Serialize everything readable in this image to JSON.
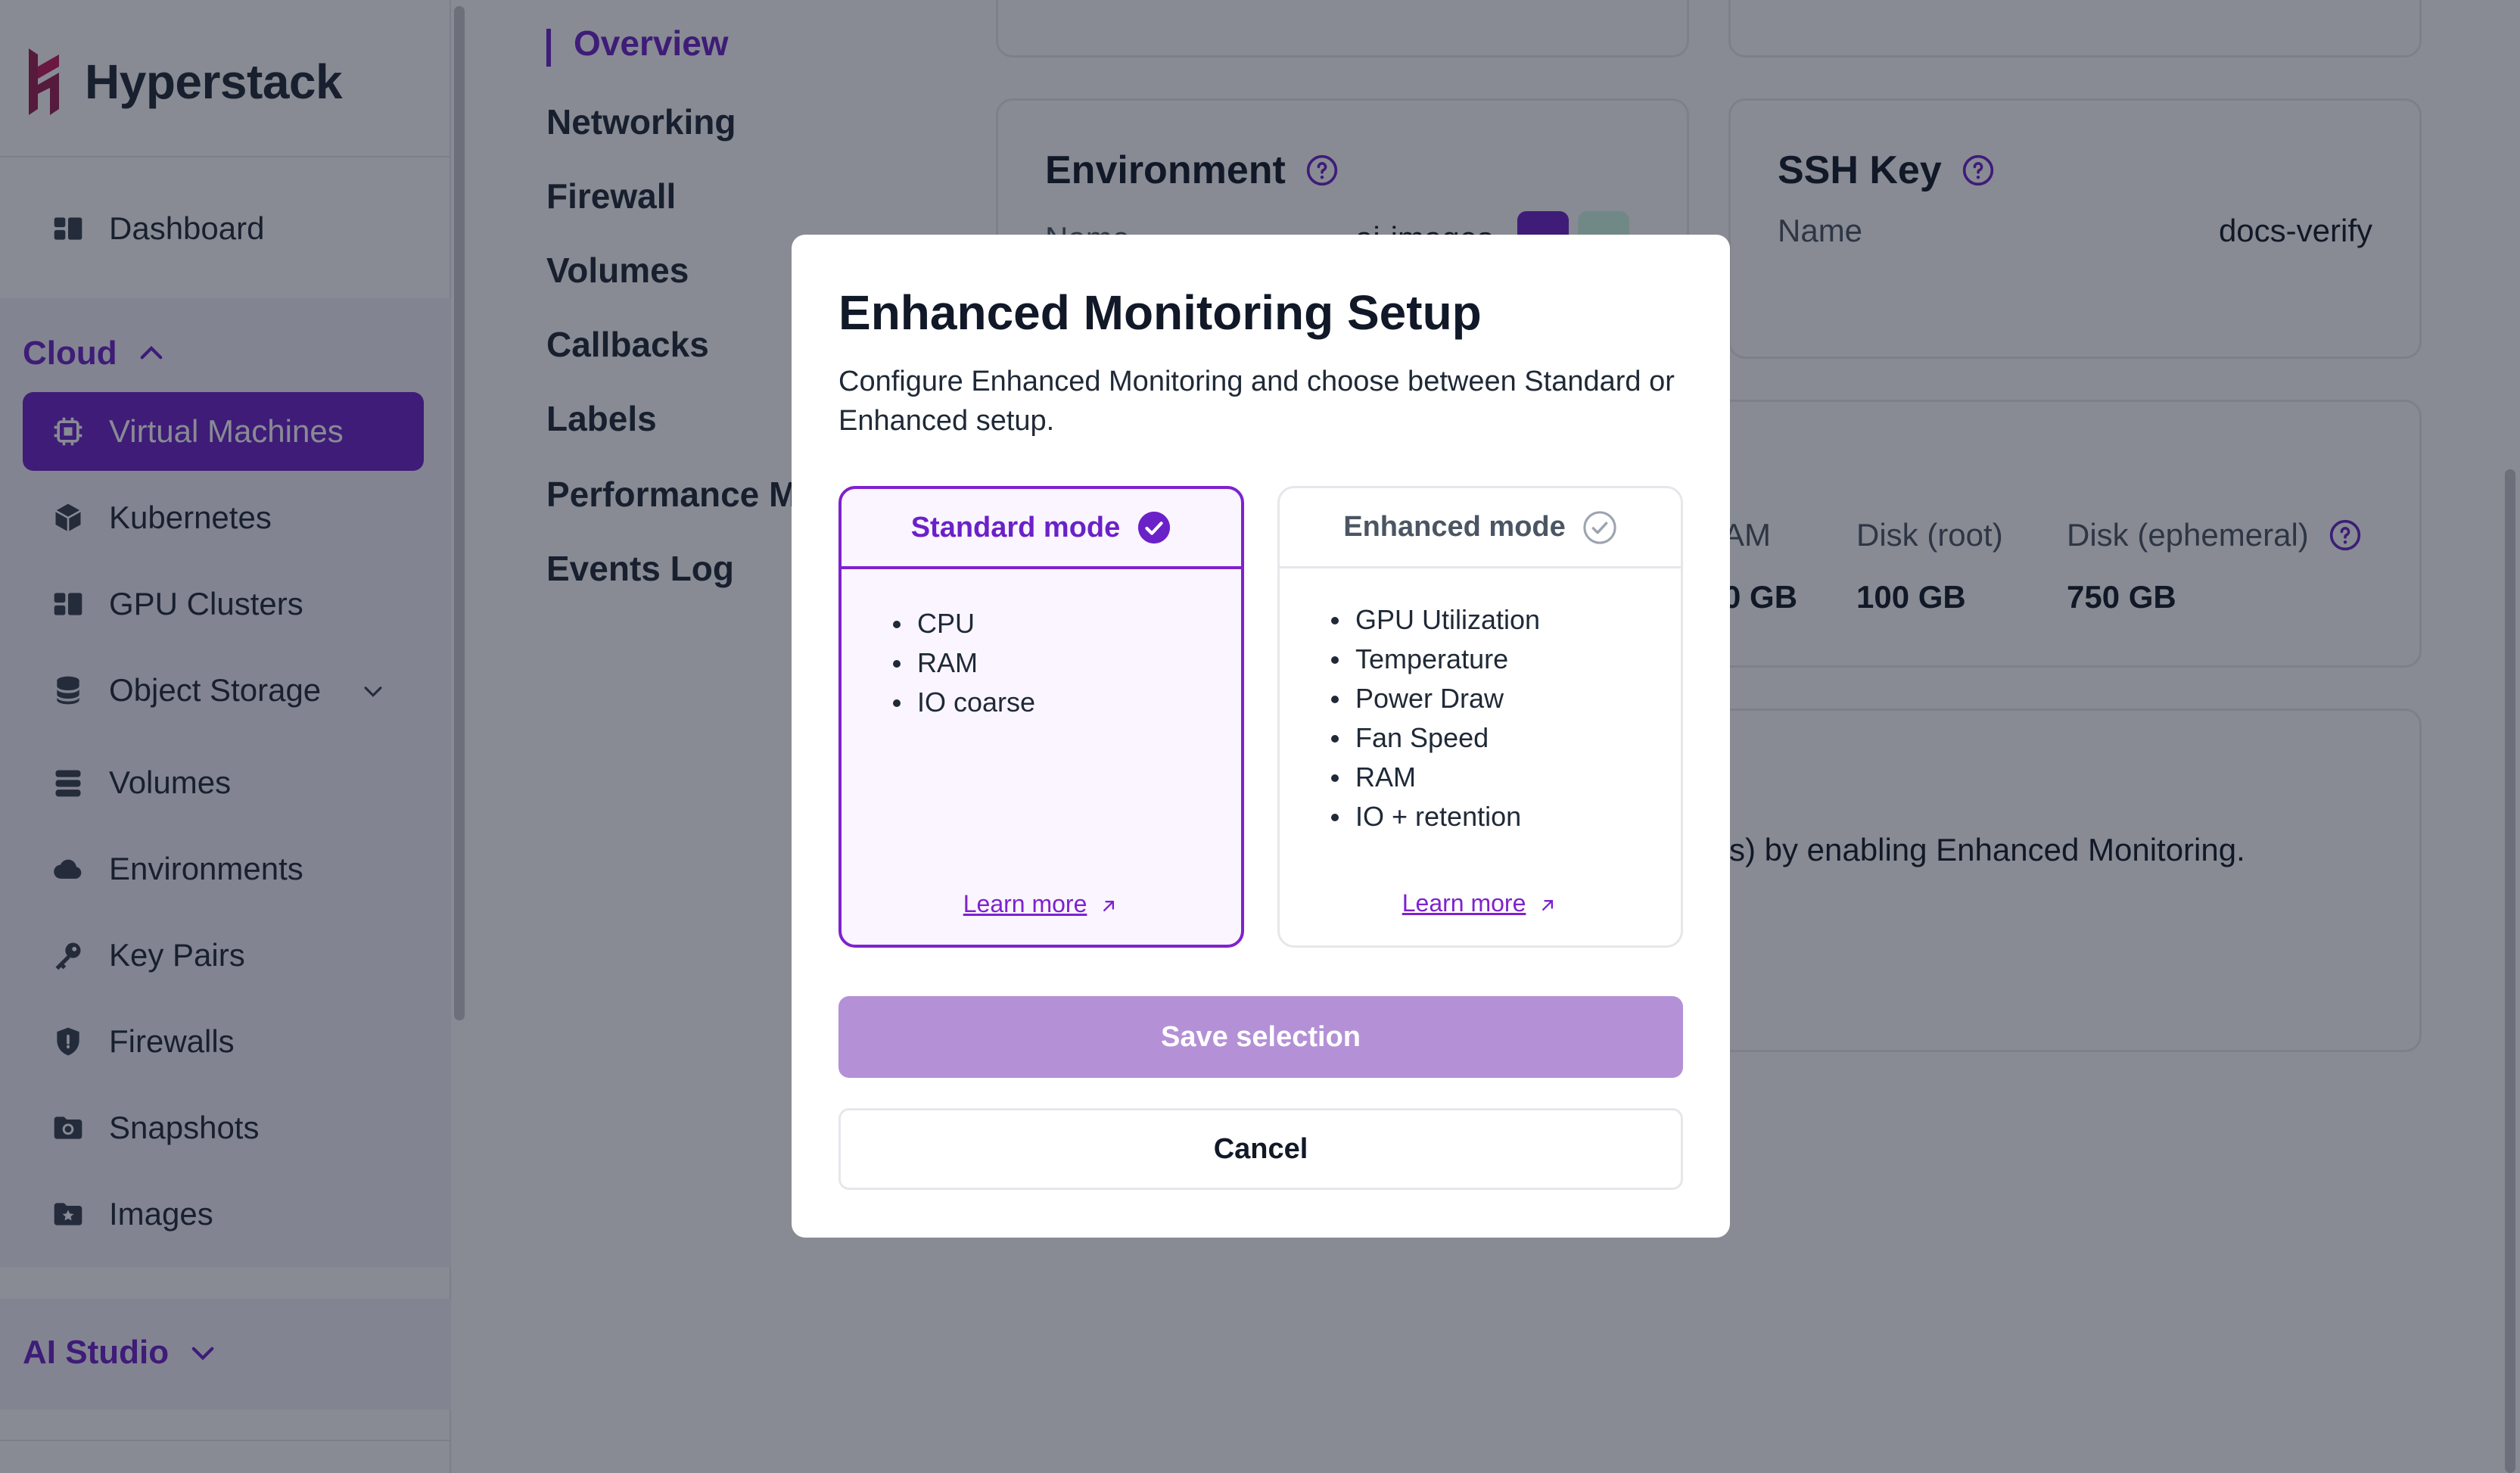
{
  "brand": {
    "name": "Hyperstack"
  },
  "sidebar": {
    "top_items": [
      {
        "label": "Dashboard",
        "icon": "dashboard-icon"
      }
    ],
    "cloud_section": {
      "label": "Cloud",
      "items": [
        {
          "label": "Virtual Machines",
          "icon": "chip-icon",
          "active": true
        },
        {
          "label": "Kubernetes",
          "icon": "cube-icon"
        },
        {
          "label": "GPU Clusters",
          "icon": "dashboard-icon"
        },
        {
          "label": "Object Storage",
          "icon": "database-icon",
          "has_submenu": true
        },
        {
          "label": "Volumes",
          "icon": "stack-icon"
        },
        {
          "label": "Environments",
          "icon": "cloud-icon"
        },
        {
          "label": "Key Pairs",
          "icon": "key-icon"
        },
        {
          "label": "Firewalls",
          "icon": "shield-icon"
        },
        {
          "label": "Snapshots",
          "icon": "snapshot-icon"
        },
        {
          "label": "Images",
          "icon": "image-icon"
        }
      ]
    },
    "ai_section": {
      "label": "AI Studio"
    }
  },
  "tabs": [
    {
      "label": "Overview",
      "active": true
    },
    {
      "label": "Networking"
    },
    {
      "label": "Firewall"
    },
    {
      "label": "Volumes"
    },
    {
      "label": "Callbacks"
    },
    {
      "label": "Labels"
    },
    {
      "label": "Performance M"
    },
    {
      "label": "Events Log"
    }
  ],
  "environment_card": {
    "title": "Environment",
    "name_label": "Name",
    "name_value": "ai-images"
  },
  "ssh_card": {
    "title": "SSH Key",
    "name_label": "Name",
    "name_value": "docs-verify"
  },
  "specs": {
    "ram_label": "AM",
    "ram_value": "0 GB",
    "disk_root_label": "Disk (root)",
    "disk_root_value": "100 GB",
    "disk_eph_label": "Disk (ephemeral)",
    "disk_eph_value": "750 GB"
  },
  "monitoring_info": {
    "text": "s) by enabling Enhanced Monitoring."
  },
  "modal": {
    "title": "Enhanced Monitoring Setup",
    "description": "Configure Enhanced Monitoring and choose between Standard or Enhanced setup.",
    "standard": {
      "label": "Standard mode",
      "features": [
        "CPU",
        "RAM",
        "IO coarse"
      ],
      "learn_more": "Learn more"
    },
    "enhanced": {
      "label": "Enhanced mode",
      "features": [
        "GPU Utilization",
        "Temperature",
        "Power Draw",
        "Fan Speed",
        "RAM",
        "IO + retention"
      ],
      "learn_more": "Learn more"
    },
    "save_label": "Save selection",
    "cancel_label": "Cancel"
  },
  "colors": {
    "accent": "#6b21c8",
    "save_disabled": "#b491d6"
  }
}
